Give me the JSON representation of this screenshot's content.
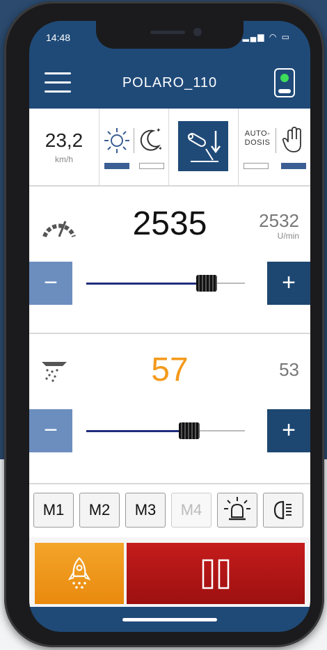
{
  "status_bar": {
    "time": "14:48",
    "icons": "▂▄▆ ◠ ▭"
  },
  "header": {
    "title": "POLARO_110"
  },
  "speed": {
    "value": "23,2",
    "unit": "km/h"
  },
  "mode_toggle": {
    "day_on": true,
    "night_on": false
  },
  "autodosis": {
    "label_line1": "AUTO-",
    "label_line2": "DOSIS",
    "auto_on": false,
    "manual_on": true
  },
  "rpm_panel": {
    "value": "2535",
    "actual": "2532",
    "unit": "U/min",
    "slider_level": 0.76,
    "minus_label": "−",
    "plus_label": "+"
  },
  "dose_panel": {
    "value": "57",
    "actual": "53",
    "slider_level": 0.65,
    "minus_label": "−",
    "plus_label": "+"
  },
  "memory_buttons": [
    "M1",
    "M2",
    "M3",
    "M4"
  ],
  "colors": {
    "brand_blue": "#1f4a78",
    "dose_orange": "#f39a1c",
    "stop_red": "#b51515"
  }
}
